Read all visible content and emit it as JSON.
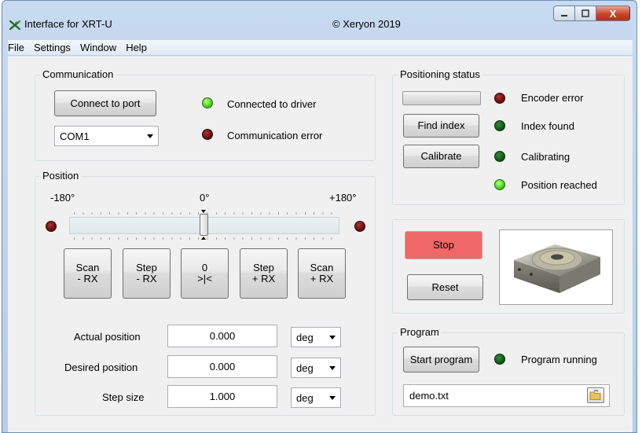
{
  "window": {
    "title": "Interface for XRT-U",
    "center_title": "© Xeryon 2019",
    "caption": {
      "minimize": "—",
      "maximize": "▢",
      "close": "X"
    }
  },
  "menu": [
    "File",
    "Settings",
    "Window",
    "Help"
  ],
  "communication": {
    "group_label": "Communication",
    "connect_button": "Connect to port",
    "port_value": "COM1",
    "connected_label": "Connected to driver",
    "error_label": "Communication error"
  },
  "position": {
    "group_label": "Position",
    "scale_min": "-180°",
    "scale_mid": "0°",
    "scale_max": "+180°",
    "slider_value_deg": 0,
    "buttons": [
      {
        "line1": "Scan",
        "line2": "- RX"
      },
      {
        "line1": "Step",
        "line2": "- RX"
      },
      {
        "line1": "0",
        "line2": ">|<"
      },
      {
        "line1": "Step",
        "line2": "+ RX"
      },
      {
        "line1": "Scan",
        "line2": "+ RX"
      }
    ],
    "actual_label": "Actual position",
    "actual_value": "0.000",
    "actual_unit": "deg",
    "desired_label": "Desired position",
    "desired_value": "0.000",
    "desired_unit": "deg",
    "step_label": "Step size",
    "step_value": "1.000",
    "step_unit": "deg"
  },
  "positioning_status": {
    "group_label": "Positioning status",
    "find_index_button": "Find index",
    "calibrate_button": "Calibrate",
    "encoder_error_label": "Encoder error",
    "index_found_label": "Index found",
    "calibrating_label": "Calibrating",
    "position_reached_label": "Position reached"
  },
  "controls": {
    "stop_button": "Stop",
    "reset_button": "Reset",
    "stop_color": "#f06767"
  },
  "program": {
    "group_label": "Program",
    "start_button": "Start program",
    "running_label": "Program running",
    "file_value": "demo.txt"
  },
  "colors": {
    "led_green_on": "#44d91a",
    "led_green_off": "#0f5a17",
    "led_red_off": "#6a0d0d"
  }
}
